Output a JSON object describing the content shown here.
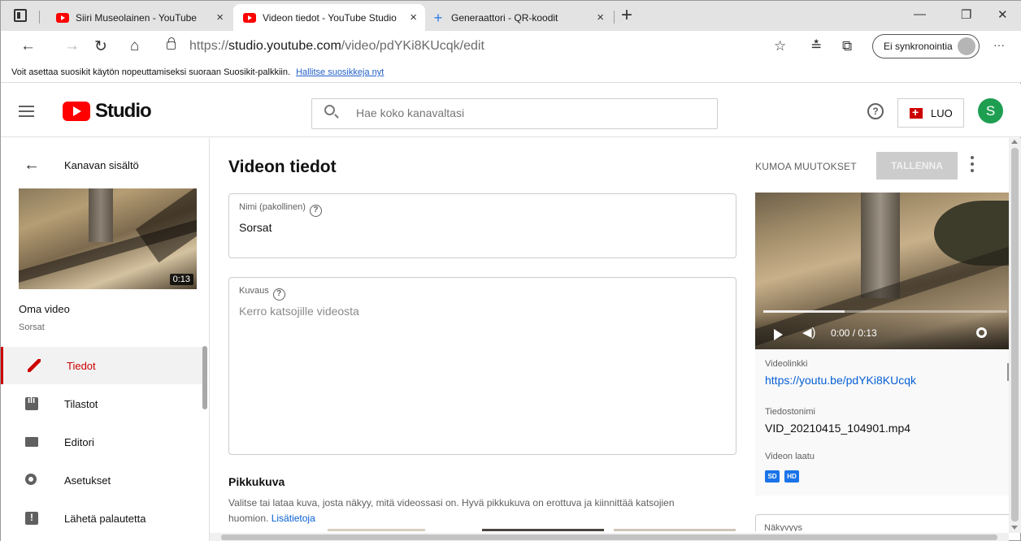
{
  "browser": {
    "tabs": [
      {
        "title": "Siiri Museolainen - YouTube",
        "icon": "youtube-icon",
        "active": false
      },
      {
        "title": "Videon tiedot - YouTube Studio",
        "icon": "youtube-icon",
        "active": true
      },
      {
        "title": "Generaattori - QR-koodit",
        "icon": "qr-sparkle-icon",
        "active": false
      }
    ],
    "close_glyph": "×",
    "new_tab_glyph": "+",
    "window_controls": {
      "minimize": "—",
      "restore": "❐",
      "close": "✕"
    },
    "url_prefix": "https://",
    "url_host": "studio.youtube.com",
    "url_path": "/video/pdYKi8KUcqk/edit",
    "sync_label": "Ei synkronointia",
    "nav_glyphs": {
      "back": "←",
      "forward": "→",
      "reload": "↻",
      "home": "⌂"
    },
    "tool_glyphs": {
      "favorite": "☆",
      "favorites": "≛",
      "collections": "⧉",
      "more": "···"
    },
    "favorites_prompt": "Voit asettaa suosikit käytön nopeuttamiseksi suoraan Suosikit-palkkiin.",
    "favorites_link": "Hallitse suosikkeja nyt"
  },
  "studio": {
    "logo_text": "Studio",
    "search_placeholder": "Hae koko kanavaltasi",
    "help_glyph": "?",
    "create_label": "LUO",
    "account_initial": "S"
  },
  "sidebar": {
    "back_glyph": "←",
    "back_label": "Kanavan sisältö",
    "thumbnail_duration": "0:13",
    "video_heading": "Oma video",
    "video_title": "Sorsat",
    "items": [
      {
        "label": "Tiedot",
        "icon": "pencil-icon",
        "active": true
      },
      {
        "label": "Tilastot",
        "icon": "analytics-icon",
        "active": false
      },
      {
        "label": "Editori",
        "icon": "clapperboard-icon",
        "active": false
      },
      {
        "label": "Asetukset",
        "icon": "gear-icon",
        "active": false
      },
      {
        "label": "Lähetä palautetta",
        "icon": "feedback-icon",
        "active": false
      }
    ]
  },
  "main": {
    "page_title": "Videon tiedot",
    "title_field": {
      "label": "Nimi (pakollinen)",
      "value": "Sorsat"
    },
    "description_field": {
      "label": "Kuvaus",
      "placeholder": "Kerro katsojille videosta"
    },
    "help_glyph": "?",
    "thumbnail_heading": "Pikkukuva",
    "thumbnail_desc": "Valitse tai lataa kuva, josta näkyy, mitä videossasi on. Hyvä pikkukuva on erottuva ja kiinnittää katsojien huomion.",
    "thumbnail_link": "Lisätietoja",
    "undo_label": "KUMOA MUUTOKSET",
    "save_label": "TALLENNA"
  },
  "video_panel": {
    "time_display": "0:00 / 0:13",
    "progress_fraction": 0,
    "volume_glyph": "◀)",
    "link_label": "Videolinkki",
    "link_value": "https://youtu.be/pdYKi8KUcqk",
    "filename_label": "Tiedostonimi",
    "filename_value": "VID_20210415_104901.mp4",
    "quality_label": "Videon laatu",
    "quality_badges": [
      "SD",
      "HD"
    ],
    "visibility_label": "Näkyvyys"
  },
  "colors": {
    "brand_red": "#ff0000",
    "active_red": "#cc0000",
    "link_blue": "#065fd4",
    "avatar_green": "#1e9e51",
    "badge_blue": "#1a73e8"
  }
}
